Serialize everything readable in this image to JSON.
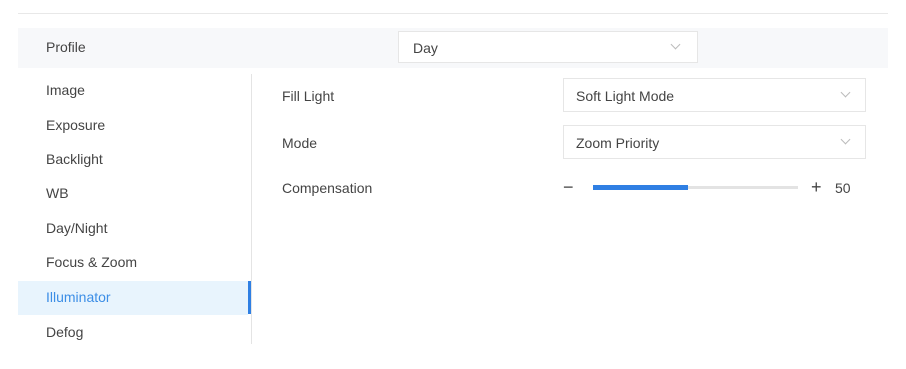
{
  "profile": {
    "label": "Profile",
    "value": "Day"
  },
  "sidebar": {
    "items": [
      {
        "label": "Image"
      },
      {
        "label": "Exposure"
      },
      {
        "label": "Backlight"
      },
      {
        "label": "WB"
      },
      {
        "label": "Day/Night"
      },
      {
        "label": "Focus & Zoom"
      },
      {
        "label": "Illuminator",
        "active": true
      },
      {
        "label": "Defog"
      }
    ]
  },
  "settings": {
    "fill_light": {
      "label": "Fill Light",
      "value": "Soft Light Mode"
    },
    "mode": {
      "label": "Mode",
      "value": "Zoom Priority"
    },
    "compensation": {
      "label": "Compensation",
      "minus": "−",
      "plus": "+",
      "value": "50",
      "level": 0.5
    }
  },
  "colors": {
    "accent": "#2f7fe3",
    "active_bg": "#e8f4fd"
  },
  "icons": {
    "select_arrow": "chevron-down-icon"
  }
}
